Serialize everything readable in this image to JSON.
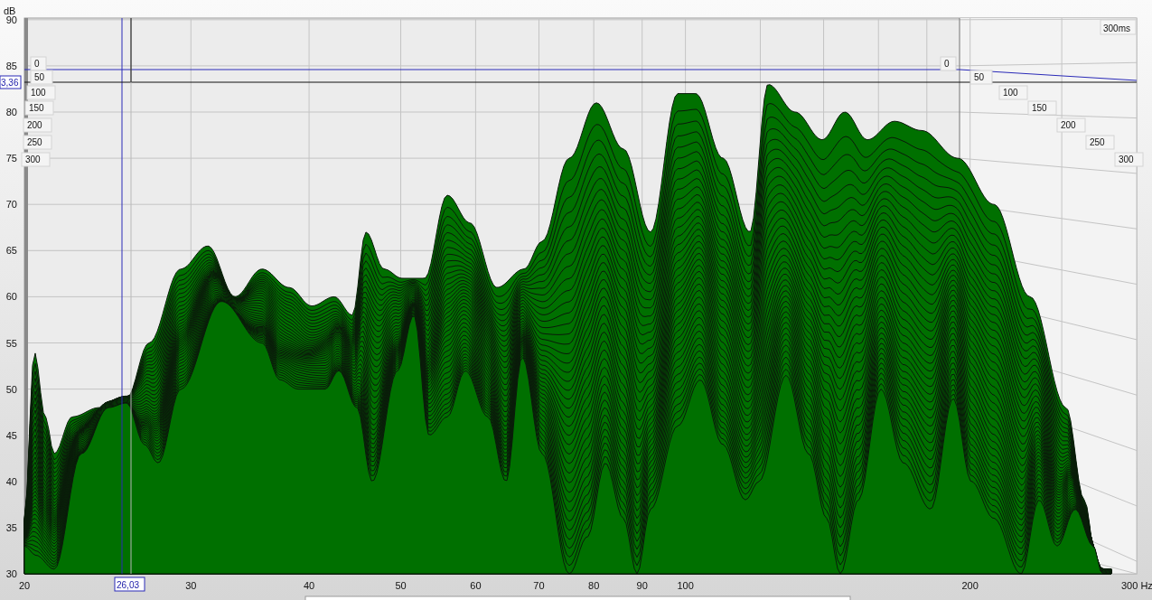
{
  "y_axis": {
    "unit": "dB",
    "ticks": [
      "90",
      "85",
      "80",
      "75",
      "70",
      "65",
      "60",
      "55",
      "50",
      "45",
      "40",
      "35",
      "30"
    ]
  },
  "x_axis": {
    "ticks": [
      "20",
      "30",
      "40",
      "50",
      "60",
      "70",
      "80",
      "90",
      "100",
      "200",
      "300 Hz"
    ]
  },
  "time_axis": {
    "corner_label": "300ms",
    "left_labels": [
      "0",
      "50",
      "100",
      "150",
      "200",
      "250",
      "300"
    ],
    "right_labels": [
      "0",
      "50",
      "100",
      "150",
      "200",
      "250",
      "300"
    ]
  },
  "cursor": {
    "level_readout": "3,36",
    "frequency_readout": "26,03"
  }
}
